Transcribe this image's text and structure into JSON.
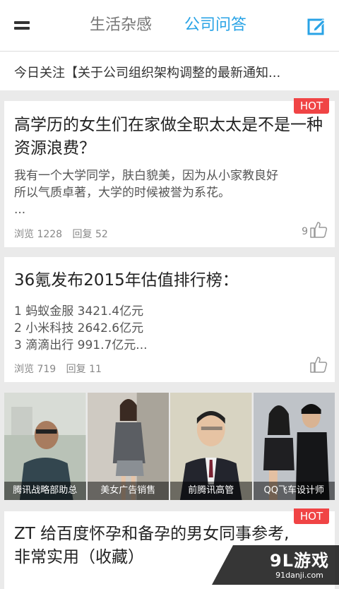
{
  "header": {
    "tabs": [
      {
        "label": "生活杂感",
        "active": false
      },
      {
        "label": "公司问答",
        "active": true
      }
    ],
    "menu_icon": "hamburger-menu-icon",
    "compose_icon": "compose-edit-icon",
    "accent_color": "#29a3e6"
  },
  "notice": {
    "text": "今日关注【关于公司组织架构调整的最新通知..."
  },
  "posts": [
    {
      "badge": "HOT",
      "title": "高学历的女生们在家做全职太太是不是一种资源浪费？",
      "excerpt": [
        "我有一个大学同学，肤白貌美，因为从小家教良好",
        "所以气质卓著，大学的时候被誉为系花。",
        "..."
      ],
      "views": "浏览 1228",
      "replies": "回复 52",
      "likes": "9"
    },
    {
      "badge": "",
      "title": "36氪发布2015年估值排行榜：",
      "excerpt": [
        "1 蚂蚁金服 3421.4亿元",
        "2 小米科技 2642.6亿元",
        "3 滴滴出行 991.7亿元..."
      ],
      "views": "浏览 719",
      "replies": "回复 11",
      "likes": ""
    },
    {
      "badge": "HOT",
      "title": "ZT 给百度怀孕和备孕的男女同事参考,非常实用（收藏）"
    }
  ],
  "gallery": [
    {
      "caption": "腾讯战略部助总"
    },
    {
      "caption": "美女广告销售"
    },
    {
      "caption": "前腾讯高管"
    },
    {
      "caption": "QQ飞车设计师"
    }
  ],
  "watermark": {
    "main": "9L游戏",
    "sub": "91danji.com"
  },
  "colors": {
    "hot_badge": "#f04445",
    "background": "#eaeaea"
  }
}
